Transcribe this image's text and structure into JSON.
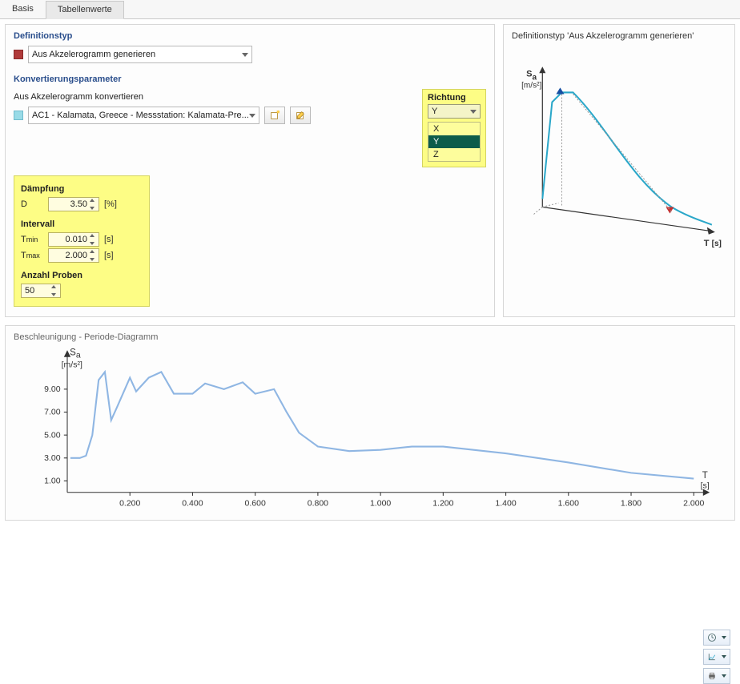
{
  "tabs": {
    "basis": "Basis",
    "tabellenwerte": "Tabellenwerte"
  },
  "def": {
    "title": "Definitionstyp",
    "selected": "Aus Akzelerogramm generieren"
  },
  "conv": {
    "title": "Konvertierungsparameter",
    "accel_label": "Aus Akzelerogramm konvertieren",
    "accel_selected": "AC1 - Kalamata, Greece - Messstation: Kalamata-Pre..."
  },
  "direction": {
    "title": "Richtung",
    "selected": "Y",
    "options": [
      "X",
      "Y",
      "Z"
    ]
  },
  "damp": {
    "title": "Dämpfung",
    "sym": "D",
    "val": "3.50",
    "unit": "[%]"
  },
  "interval": {
    "title": "Intervall",
    "tmin_label": "T",
    "tmin_sub": "min",
    "tmin_val": "0.010",
    "tmin_unit": "[s]",
    "tmax_label": "T",
    "tmax_sub": "max",
    "tmax_val": "2.000",
    "tmax_unit": "[s]"
  },
  "samples": {
    "title": "Anzahl Proben",
    "val": "50"
  },
  "right_panel": {
    "title": "Definitionstyp 'Aus Akzelerogramm generieren'",
    "y_label": "S",
    "y_sub": "a",
    "y_unit": "[m/s²]",
    "x_label": "T",
    "x_unit": "[s]"
  },
  "bottom_chart": {
    "title": "Beschleunigung - Periode-Diagramm",
    "y_label": "S",
    "y_sub": "a",
    "y_unit": "[m/s²]",
    "x_label": "T",
    "x_unit": "[s]",
    "y_ticks": [
      "1.00",
      "3.00",
      "5.00",
      "7.00",
      "9.00"
    ],
    "x_ticks": [
      "0.200",
      "0.400",
      "0.600",
      "0.800",
      "1.000",
      "1.200",
      "1.400",
      "1.600",
      "1.800",
      "2.000"
    ]
  },
  "chart_data": [
    {
      "type": "line",
      "title": "Beschleunigung - Periode-Diagramm",
      "xlabel": "T [s]",
      "ylabel": "Sa [m/s²]",
      "ylim": [
        0,
        11
      ],
      "xlim": [
        0,
        2.0
      ],
      "x": [
        0.01,
        0.04,
        0.06,
        0.08,
        0.1,
        0.12,
        0.14,
        0.16,
        0.2,
        0.22,
        0.26,
        0.3,
        0.34,
        0.4,
        0.44,
        0.5,
        0.56,
        0.6,
        0.66,
        0.7,
        0.74,
        0.8,
        0.9,
        1.0,
        1.1,
        1.2,
        1.4,
        1.6,
        1.8,
        2.0
      ],
      "values": [
        3.0,
        3.0,
        3.2,
        5.0,
        9.8,
        10.5,
        6.3,
        7.5,
        10.0,
        8.8,
        10.0,
        10.5,
        8.6,
        8.6,
        9.5,
        9.0,
        9.6,
        8.6,
        9.0,
        7.0,
        5.2,
        4.0,
        3.6,
        3.7,
        4.0,
        4.0,
        3.4,
        2.6,
        1.7,
        1.2
      ]
    },
    {
      "type": "line",
      "title": "Definitionstyp – schematisch",
      "xlabel": "T [s]",
      "ylabel": "Sa [m/s²]",
      "x": [
        0.0,
        0.04,
        0.08,
        0.12,
        0.2,
        0.35,
        0.55,
        0.8,
        1.1,
        1.5,
        2.0
      ],
      "values": [
        0.2,
        0.95,
        1.0,
        1.0,
        0.7,
        0.45,
        0.3,
        0.22,
        0.18,
        0.14,
        0.12
      ],
      "note": "schematic curve in right panel (values relative, axes unlabeled)"
    }
  ]
}
